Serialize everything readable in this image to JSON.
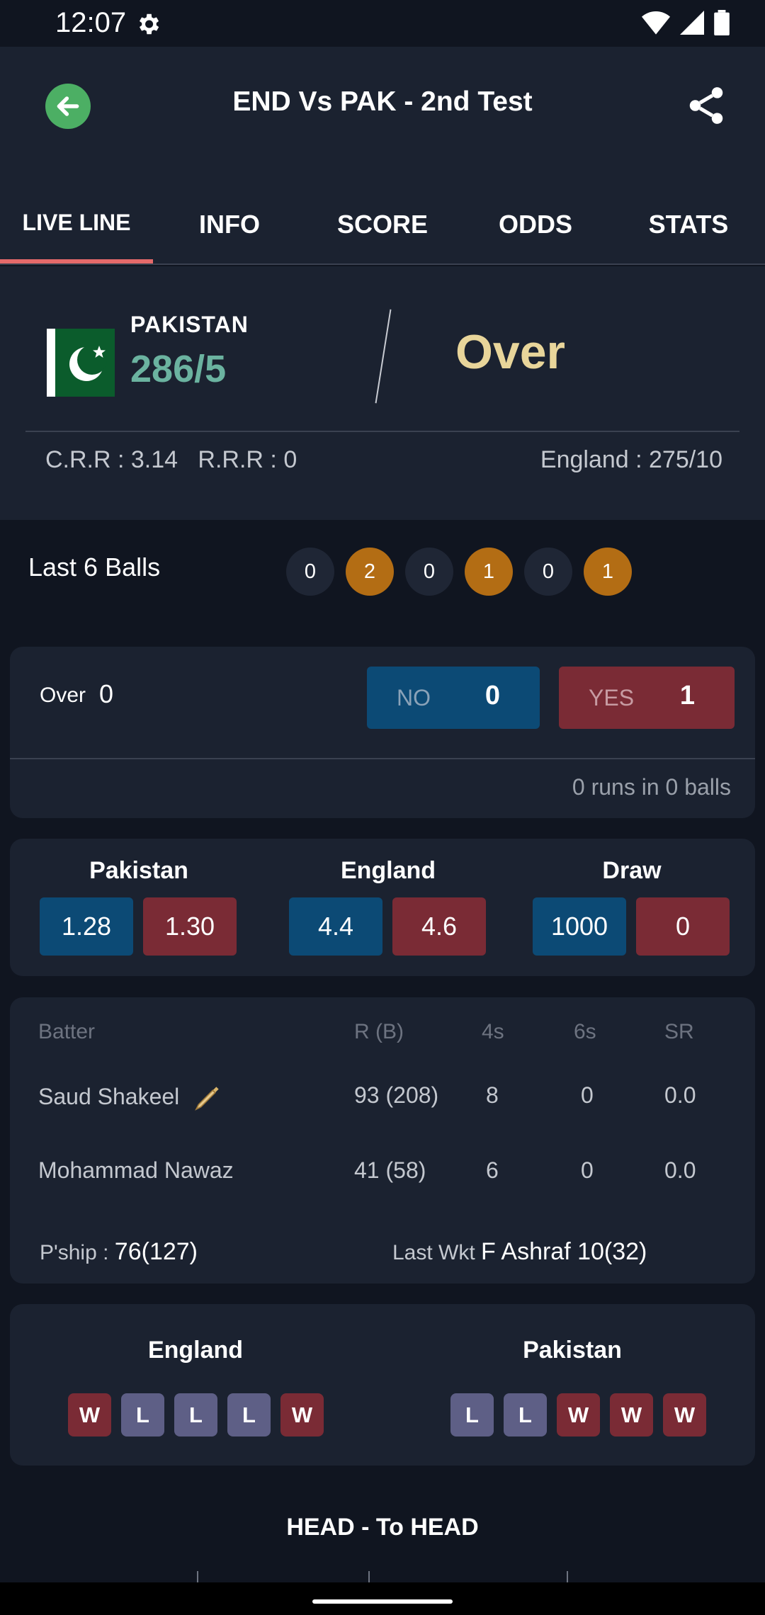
{
  "status_bar": {
    "time": "12:07"
  },
  "header": {
    "title": "END Vs PAK - 2nd Test"
  },
  "tabs": [
    {
      "label": "LIVE LINE",
      "active": true
    },
    {
      "label": "INFO",
      "active": false
    },
    {
      "label": "SCORE",
      "active": false
    },
    {
      "label": "ODDS",
      "active": false
    },
    {
      "label": "STATS",
      "active": false
    }
  ],
  "score": {
    "team": "PAKISTAN",
    "runs": "286/5",
    "status": "Over",
    "crr": "C.R.R : 3.14",
    "rrr": "R.R.R : 0",
    "target": "England : 275/10"
  },
  "last_balls": {
    "label": "Last 6 Balls",
    "balls": [
      "0",
      "2",
      "0",
      "1",
      "0",
      "1"
    ]
  },
  "session": {
    "over_label": "Over",
    "over_value": "0",
    "no_label": "NO",
    "no_value": "0",
    "yes_label": "YES",
    "yes_value": "1",
    "runs_info": "0 runs in 0 balls"
  },
  "odds": [
    {
      "name": "Pakistan",
      "back": "1.28",
      "lay": "1.30"
    },
    {
      "name": "England",
      "back": "4.4",
      "lay": "4.6"
    },
    {
      "name": "Draw",
      "back": "1000",
      "lay": "0"
    }
  ],
  "batters": {
    "headers": {
      "batter": "Batter",
      "rb": "R (B)",
      "fours": "4s",
      "sixes": "6s",
      "sr": "SR"
    },
    "rows": [
      {
        "name": "Saud Shakeel",
        "rb": "93 (208)",
        "fours": "8",
        "sixes": "0",
        "sr": "0.0"
      },
      {
        "name": "Mohammad Nawaz",
        "rb": "41 (58)",
        "fours": "6",
        "sixes": "0",
        "sr": "0.0"
      }
    ],
    "pship_label": "P'ship :",
    "pship_value": "76(127)",
    "last_wkt_label": "Last Wkt",
    "last_wkt_value": "F Ashraf 10(32)"
  },
  "form": [
    {
      "team": "England",
      "results": [
        "W",
        "L",
        "L",
        "L",
        "W"
      ]
    },
    {
      "team": "Pakistan",
      "results": [
        "L",
        "L",
        "W",
        "W",
        "W"
      ]
    }
  ],
  "head_to_head": {
    "title": "HEAD - To HEAD"
  },
  "colors": {
    "background": "#101520",
    "card": "#1b2230",
    "back_blue": "#0c4a75",
    "lay_red": "#7a2b35",
    "accent_green": "#4caf64",
    "score_teal": "#6bb3a0",
    "over_gold": "#e8d59a",
    "ball_hit": "#b36d14"
  }
}
